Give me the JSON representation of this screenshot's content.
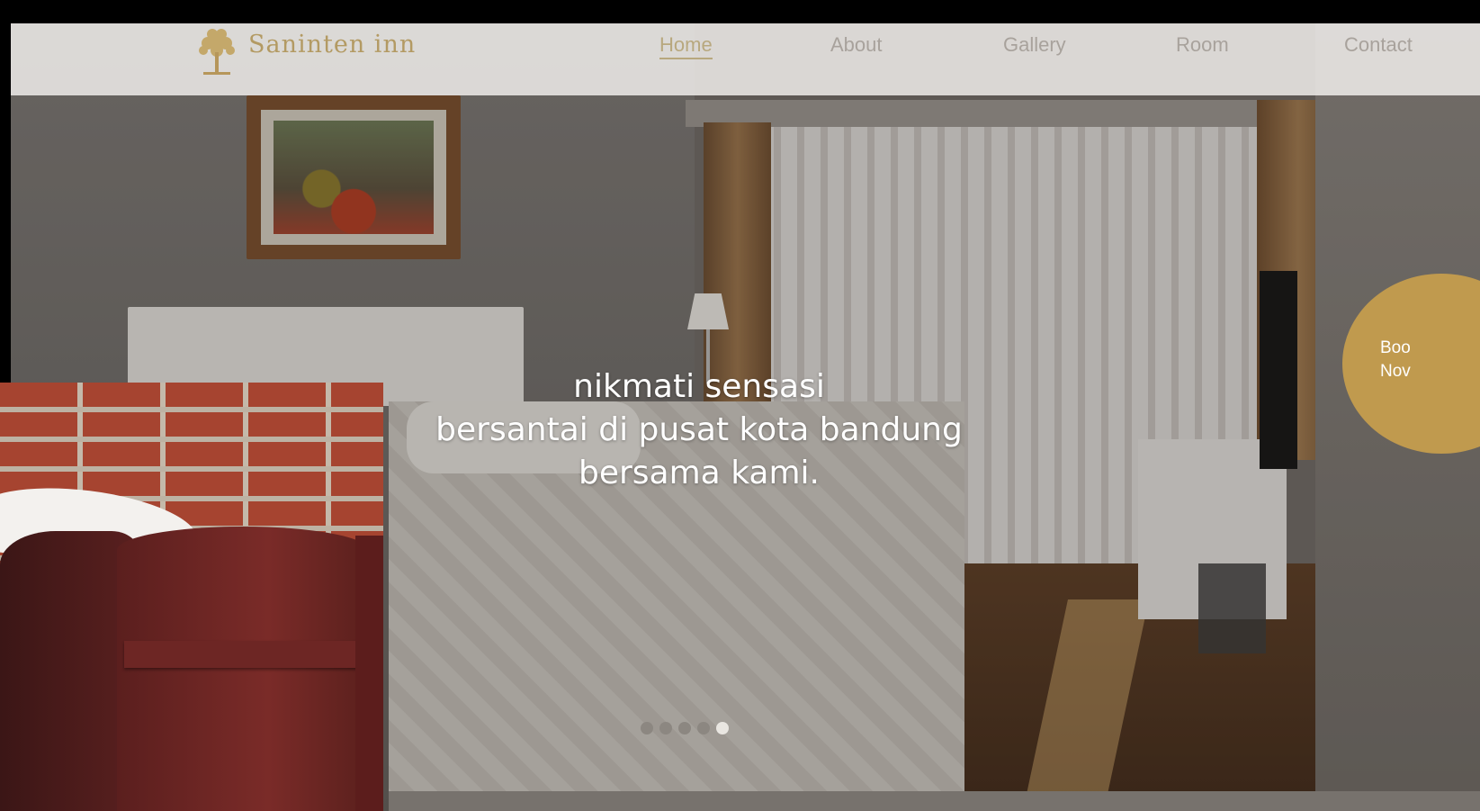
{
  "brand": {
    "name": "Saninten inn",
    "logo_icon": "tree-logo-icon",
    "accent_color": "#c09a4e"
  },
  "nav": {
    "items": [
      {
        "label": "Home",
        "active": true
      },
      {
        "label": "About",
        "active": false
      },
      {
        "label": "Gallery",
        "active": false
      },
      {
        "label": "Room",
        "active": false
      },
      {
        "label": "Contact",
        "active": false
      }
    ]
  },
  "hero": {
    "lines": [
      "nikmati sensasi",
      "bersantai di pusat kota bandung",
      "bersama kami."
    ]
  },
  "book_button": {
    "line1": "Boo",
    "line2": "Nov"
  },
  "slider": {
    "count": 5,
    "active_index": 4
  }
}
